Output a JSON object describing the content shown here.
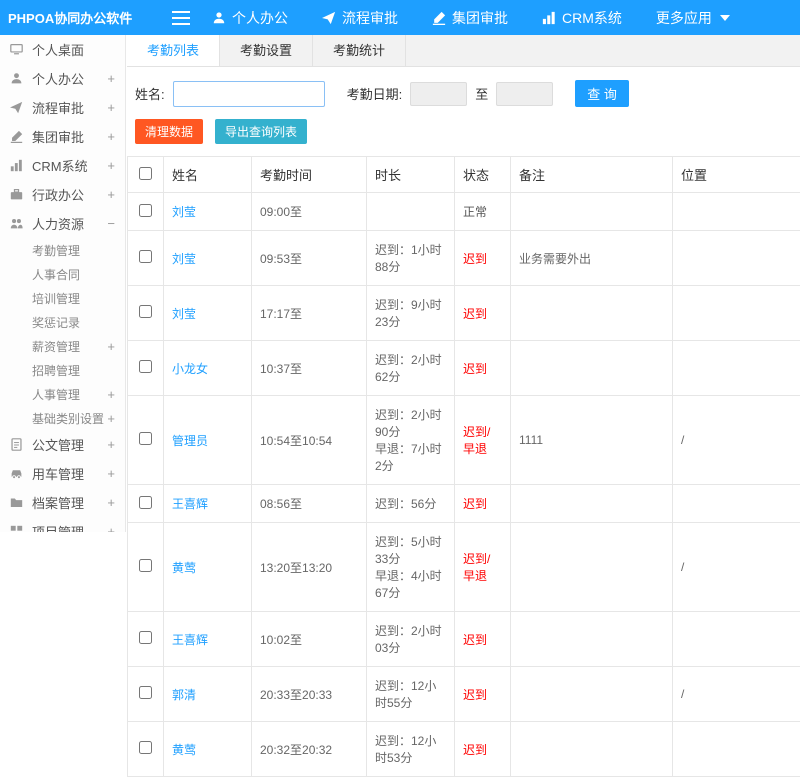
{
  "colors": {
    "topbar": "#1E9FFF",
    "accent": "#1E9FFF",
    "danger": "#FF5722",
    "export": "#34b1ce",
    "late": "#ff0000"
  },
  "topbar": {
    "logo": "PHPOA协同办公软件",
    "nav": [
      {
        "label": "个人办公",
        "icon": "user-icon"
      },
      {
        "label": "流程审批",
        "icon": "send-icon"
      },
      {
        "label": "集团审批",
        "icon": "edit-icon"
      },
      {
        "label": "CRM系统",
        "icon": "chart-icon"
      },
      {
        "label": "更多应用",
        "icon": "caret-down-icon"
      }
    ]
  },
  "sidebar": {
    "items": [
      {
        "label": "个人桌面",
        "expander": ""
      },
      {
        "label": "个人办公",
        "expander": "+"
      },
      {
        "label": "流程审批",
        "expander": "+"
      },
      {
        "label": "集团审批",
        "expander": "+"
      },
      {
        "label": "CRM系统",
        "expander": "+"
      },
      {
        "label": "行政办公",
        "expander": "+"
      },
      {
        "label": "人力资源",
        "expander": "−",
        "children": [
          {
            "label": "考勤管理",
            "expander": ""
          },
          {
            "label": "人事合同",
            "expander": ""
          },
          {
            "label": "培训管理",
            "expander": ""
          },
          {
            "label": "奖惩记录",
            "expander": ""
          },
          {
            "label": "薪资管理",
            "expander": "+"
          },
          {
            "label": "招聘管理",
            "expander": ""
          },
          {
            "label": "人事管理",
            "expander": "+"
          },
          {
            "label": "基础类别设置",
            "expander": "+"
          }
        ]
      },
      {
        "label": "公文管理",
        "expander": "+"
      },
      {
        "label": "用车管理",
        "expander": "+"
      },
      {
        "label": "档案管理",
        "expander": "+"
      },
      {
        "label": "项目管理",
        "expander": "+"
      }
    ]
  },
  "tabs": [
    {
      "label": "考勤列表",
      "active": true
    },
    {
      "label": "考勤设置",
      "active": false
    },
    {
      "label": "考勤统计",
      "active": false
    }
  ],
  "form": {
    "name_label": "姓名:",
    "name_value": "",
    "date_label": "考勤日期:",
    "date_from": "",
    "to_label": "至",
    "date_to": "",
    "search_button": "查 询"
  },
  "toolbar": {
    "clean_button": "清理数据",
    "export_button": "导出查询列表"
  },
  "table": {
    "headers": [
      "姓名",
      "考勤时间",
      "时长",
      "状态",
      "备注",
      "位置"
    ],
    "rows": [
      {
        "name": "刘莹",
        "time": "09:00至",
        "duration": "",
        "status": "正常",
        "status_type": "normal",
        "remark": "",
        "location": ""
      },
      {
        "name": "刘莹",
        "time": "09:53至",
        "duration": "迟到：1小时88分",
        "status": "迟到",
        "status_type": "late",
        "remark": "业务需要外出",
        "location": ""
      },
      {
        "name": "刘莹",
        "time": "17:17至",
        "duration": "迟到：9小时23分",
        "status": "迟到",
        "status_type": "late",
        "remark": "",
        "location": ""
      },
      {
        "name": "小龙女",
        "time": "10:37至",
        "duration": "迟到：2小时62分",
        "status": "迟到",
        "status_type": "late",
        "remark": "",
        "location": ""
      },
      {
        "name": "管理员",
        "time": "10:54至10:54",
        "duration": "迟到：2小时90分\n早退：7小时2分",
        "status": "迟到/早退",
        "status_type": "late",
        "remark": "1111",
        "location": "/"
      },
      {
        "name": "王喜辉",
        "time": "08:56至",
        "duration": "迟到：56分",
        "status": "迟到",
        "status_type": "late",
        "remark": "",
        "location": ""
      },
      {
        "name": "黄莺",
        "time": "13:20至13:20",
        "duration": "迟到：5小时33分\n早退：4小时67分",
        "status": "迟到/早退",
        "status_type": "late",
        "remark": "",
        "location": "/"
      },
      {
        "name": "王喜辉",
        "time": "10:02至",
        "duration": "迟到：2小时03分",
        "status": "迟到",
        "status_type": "late",
        "remark": "",
        "location": ""
      },
      {
        "name": "郭清",
        "time": "20:33至20:33",
        "duration": "迟到：12小时55分",
        "status": "迟到",
        "status_type": "late",
        "remark": "",
        "location": "/"
      },
      {
        "name": "黄莺",
        "time": "20:32至20:32",
        "duration": "迟到：12小时53分",
        "status": "迟到",
        "status_type": "late",
        "remark": "",
        "location": ""
      }
    ]
  }
}
